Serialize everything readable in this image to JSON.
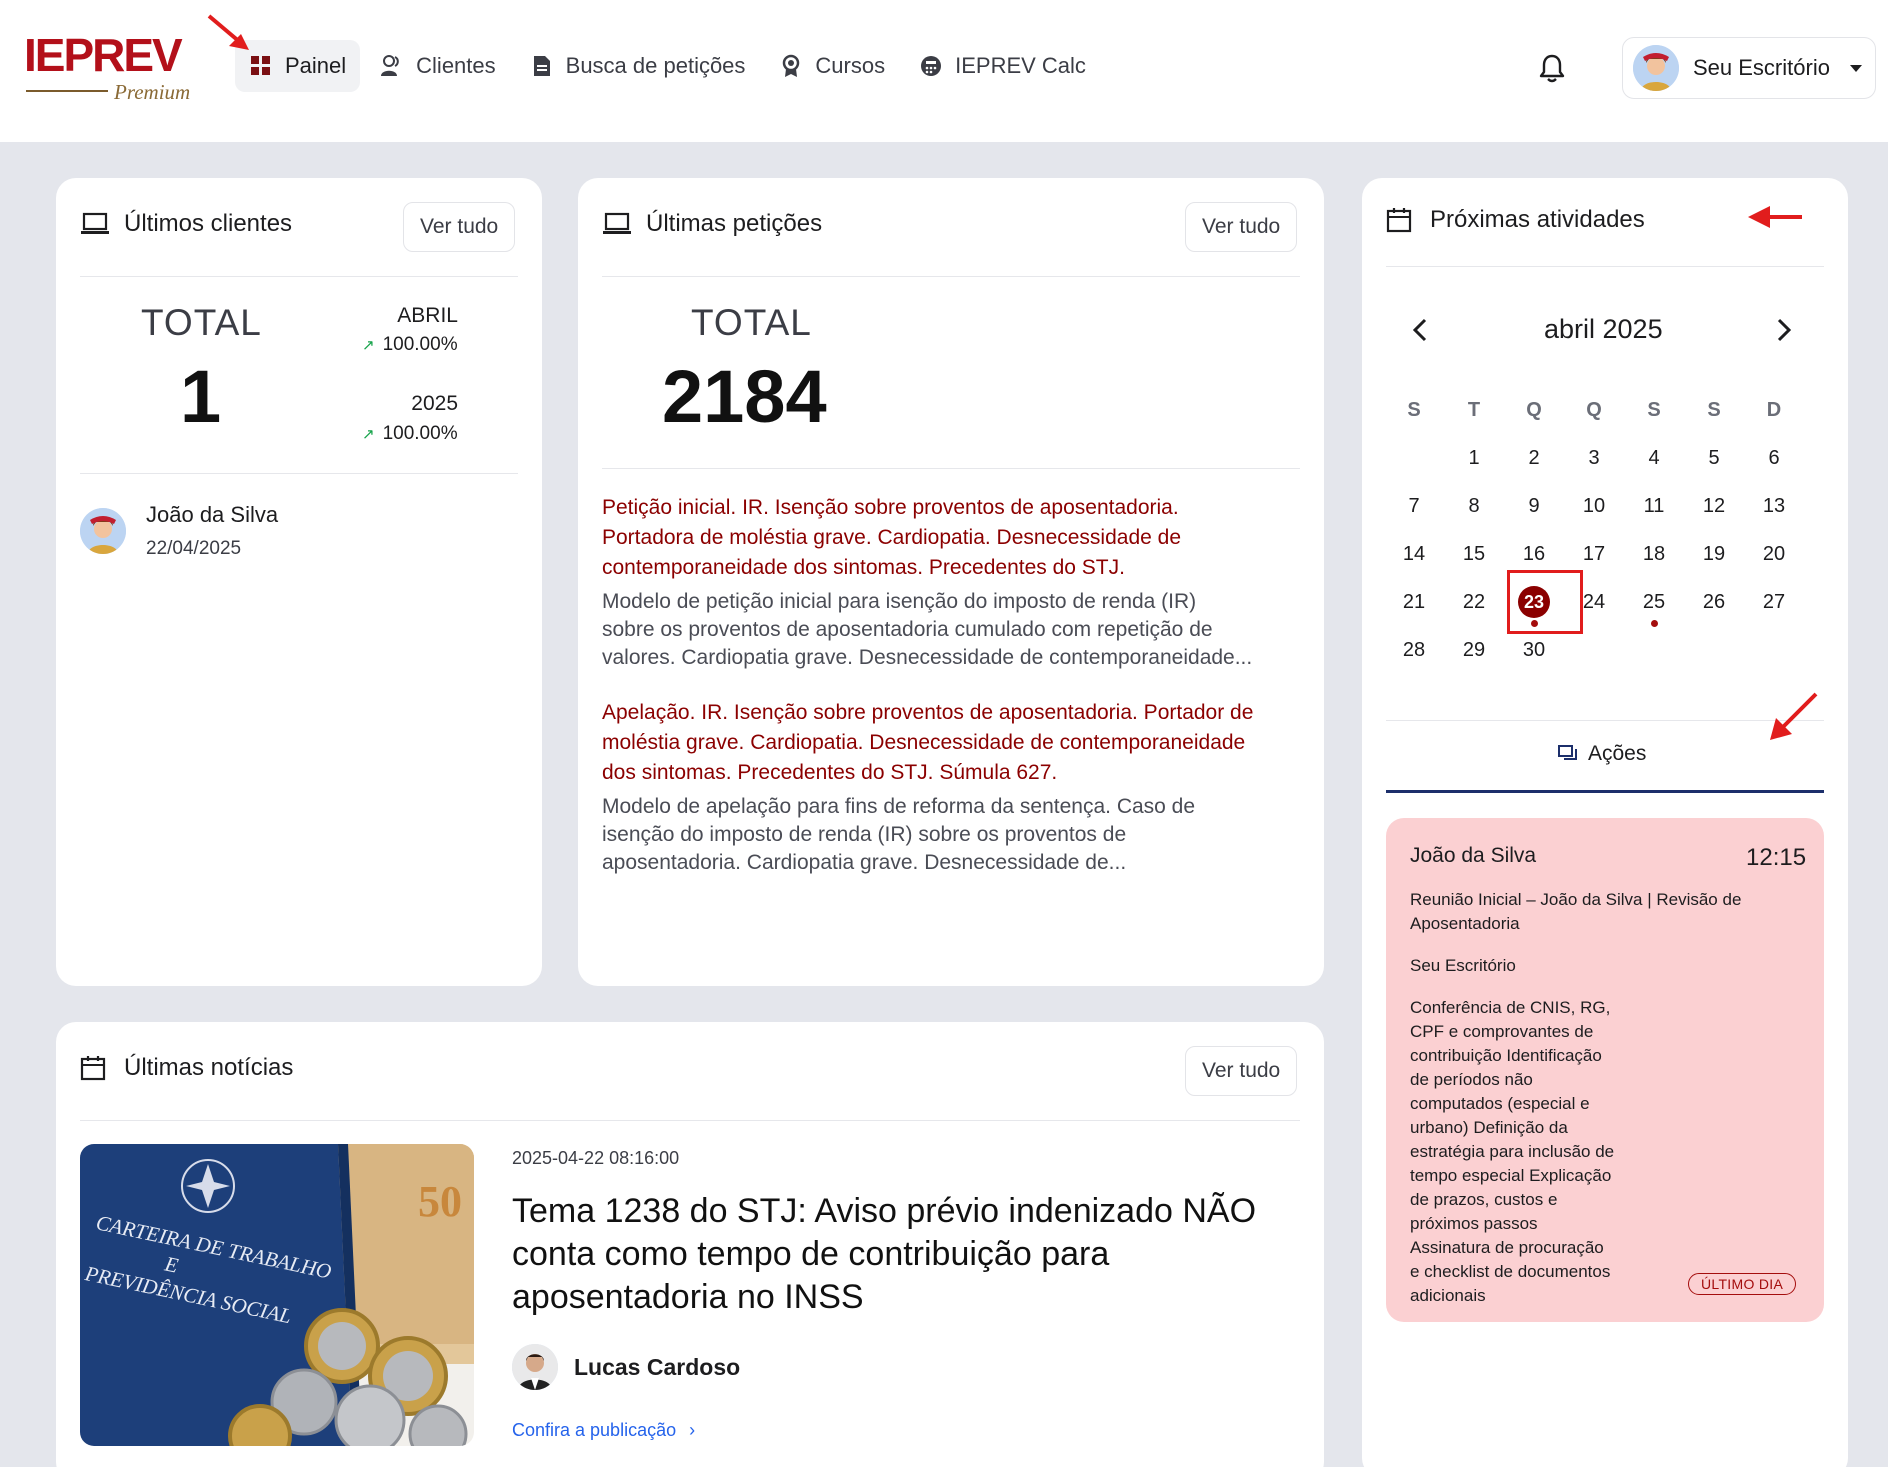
{
  "brand": {
    "name": "IEPREV",
    "tier": "Premium",
    "color": "#b3101a"
  },
  "nav": [
    {
      "label": "Painel",
      "icon": "grid-icon",
      "active": true
    },
    {
      "label": "Clientes",
      "icon": "users-icon"
    },
    {
      "label": "Busca de petições",
      "icon": "document-icon"
    },
    {
      "label": "Cursos",
      "icon": "award-icon"
    },
    {
      "label": "IEPREV Calc",
      "icon": "calculator-icon"
    }
  ],
  "user": {
    "office": "Seu Escritório"
  },
  "ver_tudo": "Ver tudo",
  "clients_card": {
    "title": "Últimos clientes",
    "total_label": "TOTAL",
    "total_value": "1",
    "periods": [
      {
        "label": "ABRIL",
        "pct": "100.00%"
      },
      {
        "label": "2025",
        "pct": "100.00%"
      }
    ],
    "items": [
      {
        "name": "João da Silva",
        "date": "22/04/2025"
      }
    ]
  },
  "petitions_card": {
    "title": "Últimas petições",
    "total_label": "TOTAL",
    "total_value": "2184",
    "items": [
      {
        "title_lines": [
          "Petição inicial. IR. Isenção sobre proventos de aposentadoria.",
          "Portadora de moléstia grave. Cardiopatia. Desnecessidade de",
          "contemporaneidade dos sintomas. Precedentes do STJ."
        ],
        "desc_lines": [
          "Modelo de petição inicial para isenção do imposto de renda (IR)",
          "sobre os proventos de aposentadoria cumulado com repetição de",
          "valores. Cardiopatia grave. Desnecessidade de contemporaneidade..."
        ]
      },
      {
        "title_lines": [
          "Apelação. IR. Isenção sobre proventos de aposentadoria. Portador de",
          "moléstia grave. Cardiopatia. Desnecessidade de contemporaneidade",
          "dos sintomas. Precedentes do STJ. Súmula 627."
        ],
        "desc_lines": [
          "Modelo de apelação para fins de reforma da sentença. Caso de",
          "isenção do imposto de renda (IR) sobre os proventos de",
          "aposentadoria. Cardiopatia grave. Desnecessidade de..."
        ]
      }
    ]
  },
  "activities_card": {
    "title": "Próximas atividades",
    "month": "abril 2025",
    "weekdays": [
      "S",
      "T",
      "Q",
      "Q",
      "S",
      "S",
      "D"
    ],
    "first_weekday_offset": 1,
    "days_in_month": 30,
    "selected_day": 23,
    "event_days": [
      23,
      25
    ],
    "tab": "Ações",
    "activity": {
      "client": "João da Silva",
      "time": "12:15",
      "title_lines": [
        "Reunião Inicial – João da Silva | Revisão de",
        "Aposentadoria"
      ],
      "office": "Seu Escritório",
      "description_lines": [
        "Conferência de CNIS, RG,",
        "CPF e comprovantes de",
        "contribuição Identificação",
        "de períodos não",
        "computados (especial e",
        "urbano) Definição da",
        "estratégia para inclusão de",
        "tempo especial Explicação",
        "de prazos, custos e",
        "próximos passos",
        "Assinatura de procuração",
        "e checklist de documentos",
        "adicionais"
      ],
      "badge": "ÚLTIMO DIA",
      "color": "#fbd0d2"
    }
  },
  "news_card": {
    "title": "Últimas notícias",
    "items": [
      {
        "date": "2025-04-22 08:16:00",
        "title_lines": [
          "Tema 1238 do STJ: Aviso prévio indenizado NÃO",
          "conta como tempo de contribuição para",
          "aposentadoria no INSS"
        ],
        "author": "Lucas Cardoso",
        "link": "Confira a publicação",
        "image": {
          "booklet_lines": [
            "CARTEIRA DE TRABALHO",
            "E",
            "PREVIDÊNCIA SOCIAL"
          ],
          "banknote_value": "50"
        }
      }
    ]
  },
  "colors": {
    "accent": "#8b0000",
    "tab_underline": "#1c2f6b",
    "link": "#2563eb",
    "annotation_arrow": "#e11d1d"
  }
}
